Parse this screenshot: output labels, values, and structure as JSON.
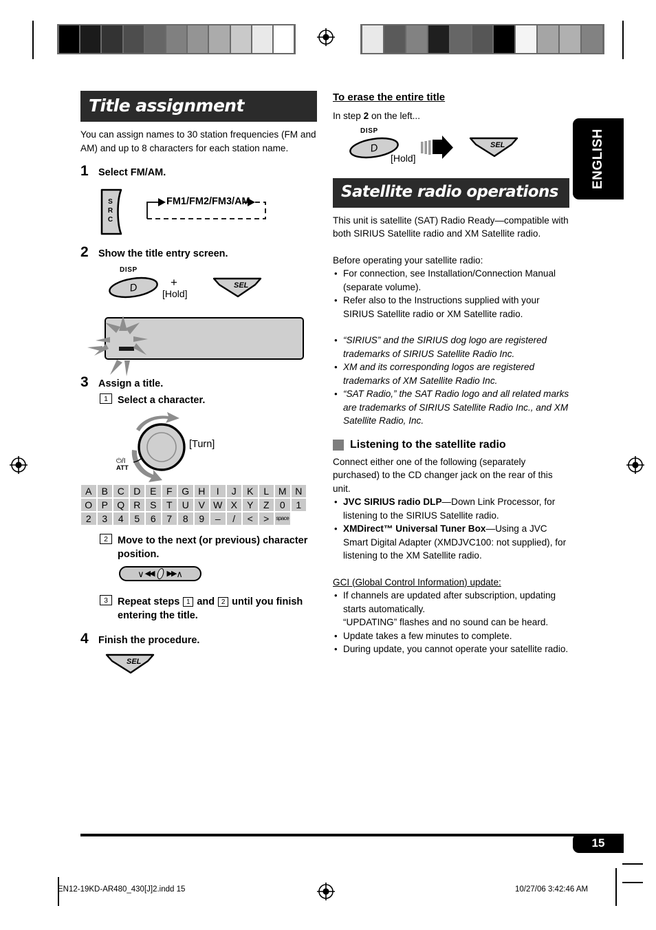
{
  "colors": {
    "banner_bg": "#2b2b2b",
    "button_fill": "#cfcfcf",
    "grid_fill": "#c9c9c9",
    "subhead_square": "#7d7d7d",
    "tab_bg": "#000000"
  },
  "calibration": {
    "left_bar_swatches": [
      "#000000",
      "#1b1b1b",
      "#333333",
      "#4d4d4d",
      "#666666",
      "#808080",
      "#949494",
      "#ababab",
      "#c9c9c9",
      "#e9e9e9",
      "#ffffff"
    ],
    "right_bar_swatches": [
      "#e9e9e9",
      "#5a5a5a",
      "#828282",
      "#1f1f1f",
      "#666666",
      "#565656",
      "#000000",
      "#f4f4f4",
      "#a5a5a5",
      "#b0b0b0",
      "#828282"
    ]
  },
  "side_tab": {
    "label": "ENGLISH"
  },
  "left_column": {
    "banner": "Title assignment",
    "intro": "You can assign names to 30 station frequencies (FM and AM) and up to 8 characters for each station name.",
    "step1": {
      "num": "1",
      "title": "Select FM/AM.",
      "button_label_lines": [
        "S",
        "R",
        "C"
      ],
      "loop_text": "FM1/FM2/FM3/AM"
    },
    "step2": {
      "num": "2",
      "title": "Show the title entry screen.",
      "disp_label": "DISP",
      "disp_key": "D",
      "plus": "+",
      "hold": "[Hold]",
      "sel_key": "SEL"
    },
    "step3": {
      "num": "3",
      "title": "Assign a title.",
      "sub1": {
        "num": "1",
        "text": "Select a character."
      },
      "knob_label_line1": "⏻/I",
      "knob_label_line2": "ATT",
      "turn": "[Turn]",
      "char_rows": [
        [
          "A",
          "B",
          "C",
          "D",
          "E",
          "F",
          "G",
          "H",
          "I",
          "J",
          "K",
          "L",
          "M",
          "N"
        ],
        [
          "O",
          "P",
          "Q",
          "R",
          "S",
          "T",
          "U",
          "V",
          "W",
          "X",
          "Y",
          "Z",
          "0",
          "1"
        ],
        [
          "2",
          "3",
          "4",
          "5",
          "6",
          "7",
          "8",
          "9",
          "–",
          "/",
          "<",
          ">",
          "space"
        ]
      ],
      "sub2": {
        "num": "2",
        "text": "Move to the next (or previous) character position."
      },
      "sub3": {
        "num": "3",
        "text_a": "Repeat steps",
        "box1": "1",
        "text_b": "and",
        "box2": "2",
        "text_c": "until you finish entering the title."
      }
    },
    "step4": {
      "num": "4",
      "title": "Finish the procedure.",
      "sel_key": "SEL"
    }
  },
  "right_column": {
    "erase_heading": "To erase the entire title",
    "erase_line_a": "In step",
    "erase_line_step": "2",
    "erase_line_b": "on the left...",
    "erase_disp_label": "DISP",
    "erase_disp_key": "D",
    "erase_hold": "[Hold]",
    "erase_sel_key": "SEL",
    "banner": "Satellite radio operations",
    "intro": "This unit is satellite (SAT) Radio Ready—compatible with both SIRIUS Satellite radio and XM Satellite radio.",
    "before_heading": "Before operating your satellite radio:",
    "before_bullets": [
      "For connection, see Installation/Connection Manual (separate volume).",
      "Refer also to the Instructions supplied with your SIRIUS Satellite radio or XM Satellite radio."
    ],
    "trademark_bullets": [
      "“SIRIUS” and the SIRIUS dog logo are registered trademarks of SIRIUS Satellite Radio Inc.",
      "XM and its corresponding logos are registered trademarks of XM Satellite Radio Inc.",
      "“SAT Radio,” the SAT Radio logo and all related marks are trademarks of SIRIUS Satellite Radio Inc., and XM Satellite Radio, Inc."
    ],
    "listening_heading": "Listening to the satellite radio",
    "listening_intro": "Connect either one of the following (separately purchased) to the CD changer jack on the rear of this unit.",
    "device_bullets": [
      {
        "bold": "JVC SIRIUS radio DLP",
        "rest": "—Down Link Processor, for listening to the SIRIUS Satellite radio."
      },
      {
        "bold": "XMDirect™ Universal Tuner Box",
        "rest": "—Using a JVC Smart Digital Adapter (XMDJVC100: not supplied), for listening to the XM Satellite radio."
      }
    ],
    "gci_heading": "GCI (Global Control Information) update:",
    "gci_bullets": [
      "If channels are updated after subscription, updating starts automatically.\n“UPDATING” flashes and no sound can be heard.",
      "Update takes a few minutes to complete.",
      "During update, you cannot operate your satellite radio."
    ]
  },
  "footer": {
    "page_number": "15",
    "file_name": "EN12-19KD-AR480_430[J]2.indd   15",
    "timestamp": "10/27/06   3:42:46 AM"
  }
}
